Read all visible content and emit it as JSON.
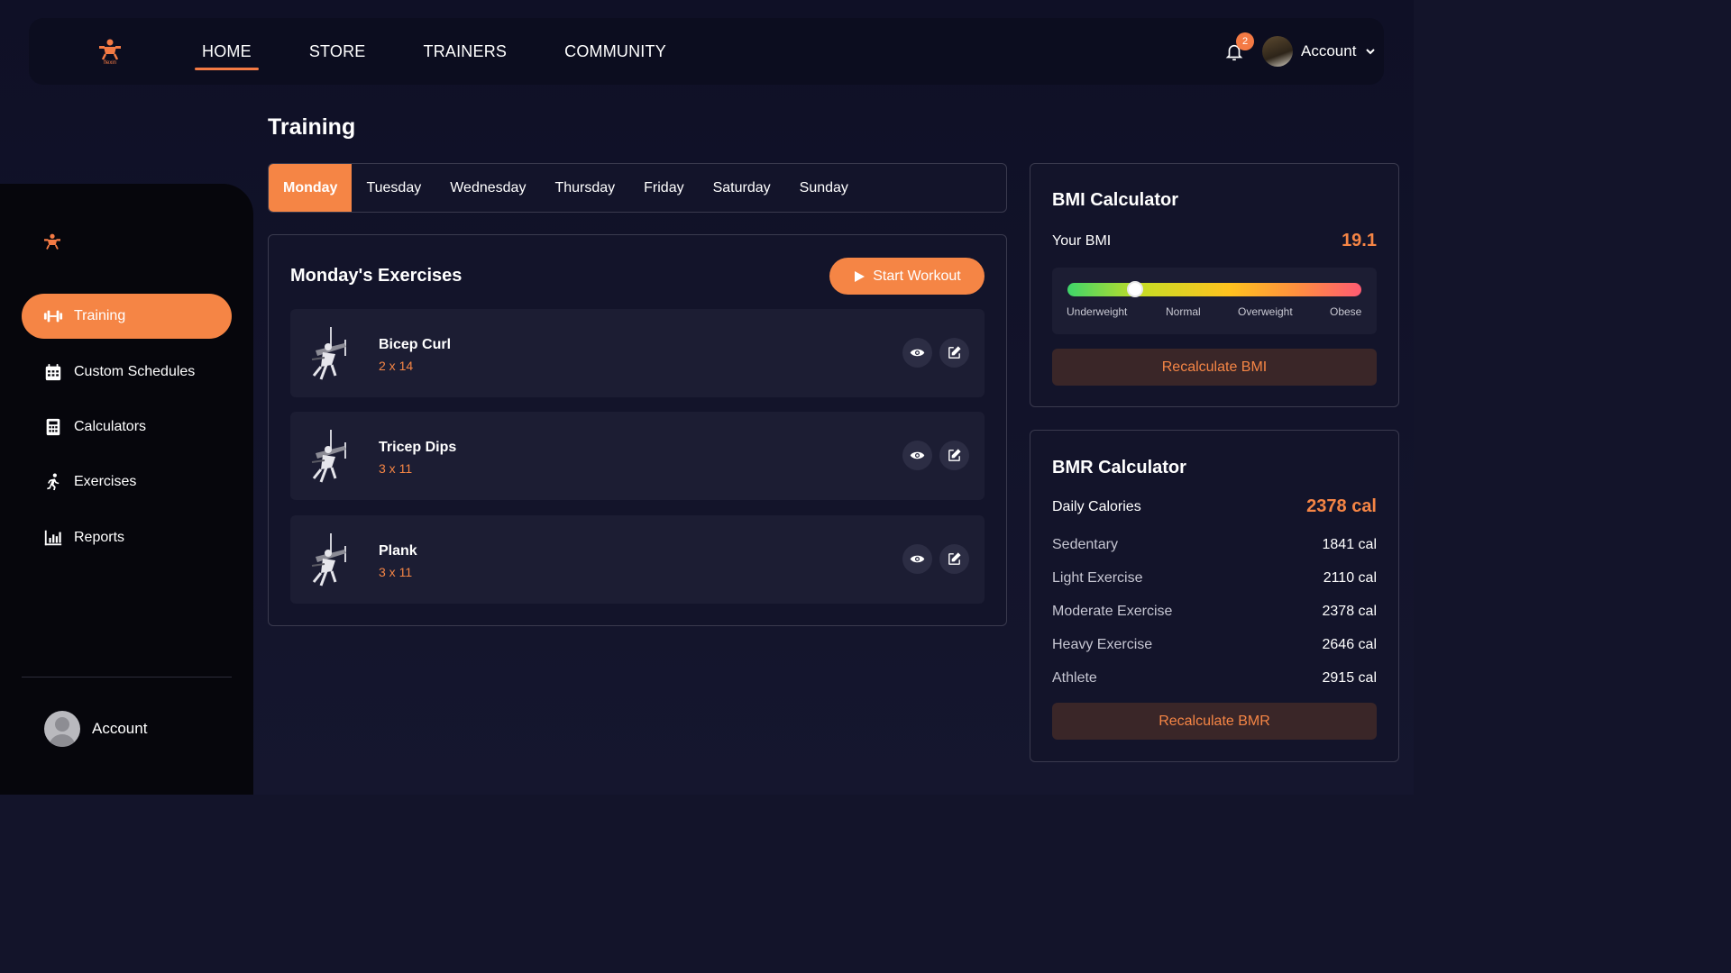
{
  "nav": {
    "items": [
      {
        "label": "HOME",
        "active": true
      },
      {
        "label": "STORE",
        "active": false
      },
      {
        "label": "TRAINERS",
        "active": false
      },
      {
        "label": "COMMUNITY",
        "active": false
      }
    ],
    "notification_count": "2",
    "account_label": "Account"
  },
  "sidebar": {
    "items": [
      {
        "label": "Training",
        "icon": "dumbbell-icon",
        "active": true
      },
      {
        "label": "Custom Schedules",
        "icon": "calendar-icon",
        "active": false
      },
      {
        "label": "Calculators",
        "icon": "calculator-icon",
        "active": false
      },
      {
        "label": "Exercises",
        "icon": "running-icon",
        "active": false
      },
      {
        "label": "Reports",
        "icon": "bar-chart-icon",
        "active": false
      }
    ],
    "account_label": "Account"
  },
  "main": {
    "title": "Training",
    "days": [
      "Monday",
      "Tuesday",
      "Wednesday",
      "Thursday",
      "Friday",
      "Saturday",
      "Sunday"
    ],
    "active_day": "Monday",
    "exercises_title": "Monday's Exercises",
    "start_label": "Start Workout",
    "exercises": [
      {
        "name": "Bicep Curl",
        "sets": "2 x 14"
      },
      {
        "name": "Tricep Dips",
        "sets": "3 x 11"
      },
      {
        "name": "Plank",
        "sets": "3 x 11"
      }
    ]
  },
  "bmi": {
    "title": "BMI Calculator",
    "label": "Your BMI",
    "value": "19.1",
    "indicator_fraction": 0.23,
    "scale": [
      "Underweight",
      "Normal",
      "Overweight",
      "Obese"
    ],
    "button": "Recalculate BMI"
  },
  "bmr": {
    "title": "BMR Calculator",
    "daily_label": "Daily Calories",
    "daily_value": "2378 cal",
    "levels": [
      {
        "label": "Sedentary",
        "value": "1841 cal"
      },
      {
        "label": "Light Exercise",
        "value": "2110 cal"
      },
      {
        "label": "Moderate Exercise",
        "value": "2378 cal"
      },
      {
        "label": "Heavy Exercise",
        "value": "2646 cal"
      },
      {
        "label": "Athlete",
        "value": "2915 cal"
      }
    ],
    "button": "Recalculate BMR"
  },
  "colors": {
    "accent": "#f58545",
    "background": "#13142a",
    "sidebar": "#06060c",
    "card_row": "#1c1d33"
  }
}
